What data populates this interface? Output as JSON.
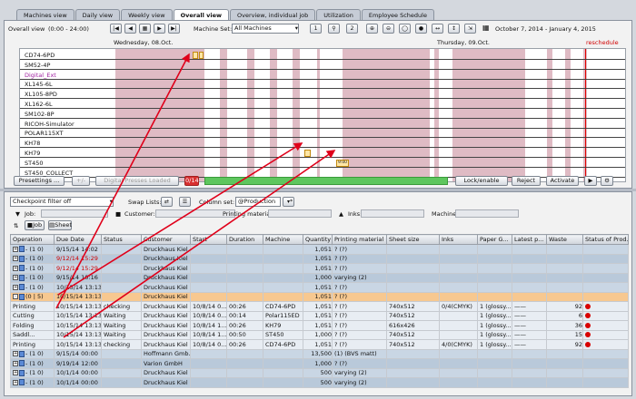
{
  "tabs": [
    {
      "label": "Machines view"
    },
    {
      "label": "Daily view"
    },
    {
      "label": "Weekly view"
    },
    {
      "label": "Overall view",
      "active": true
    },
    {
      "label": "Overview, individual job"
    },
    {
      "label": "Utilization"
    },
    {
      "label": "Employee Schedule"
    }
  ],
  "toolbar": {
    "view_label": "Overall view",
    "time_range": "(0:00 - 24:00)",
    "machine_set_label": "Machine Set:",
    "machine_set_value": "All Machines",
    "btn_one": "1",
    "btn_two": "2",
    "date_range": "October 7, 2014  -  January 4, 2015"
  },
  "gantt": {
    "day1": "Wednesday, 08.Oct.",
    "day2": "Thursday, 09.Oct.",
    "reschedule": "reschedule",
    "machines": [
      {
        "name": "CD74-6PD",
        "color": "#111111"
      },
      {
        "name": "SM52-4P",
        "color": "#111111"
      },
      {
        "name": "Digital_Ext",
        "color": "#a020a0"
      },
      {
        "name": "XL145-6L",
        "color": "#111111"
      },
      {
        "name": "XL105-8PD",
        "color": "#111111"
      },
      {
        "name": "XL162-6L",
        "color": "#111111"
      },
      {
        "name": "SM102-8P",
        "color": "#111111"
      },
      {
        "name": "RICOH-Simulator",
        "color": "#111111"
      },
      {
        "name": "POLAR115XT",
        "color": "#111111"
      },
      {
        "name": "KH78",
        "color": "#111111"
      },
      {
        "name": "KH79",
        "color": "#111111"
      },
      {
        "name": "ST450",
        "color": "#111111"
      },
      {
        "name": "ST450_COLLECT",
        "color": "#111111"
      }
    ],
    "st450_block_label": "9:00"
  },
  "bottombar": {
    "presettings": "Presettings ...",
    "digital": "Digital Presses Loaded",
    "count": "0/14",
    "lock": "Lock/enable",
    "reject": "Reject",
    "activate": "Activate"
  },
  "filters": {
    "checkpoint": "Checkpoint filter off",
    "swap_lists": "Swap Lists:",
    "column_set_label": "Column set:",
    "column_set_value": "@Production",
    "job_label": "Job:",
    "customer_label": "Customer:",
    "printing_material_label": "Printing material:",
    "inks_label": "Inks:",
    "machine_label": "Machine:",
    "job_btn": "Job",
    "sheet_btn": "Sheet"
  },
  "columns": [
    "Operation",
    "Due Date",
    "Status",
    "Customer",
    "Start",
    "Duration",
    "Machine",
    "Quantity",
    "Printing material",
    "Sheet size",
    "Inks",
    "Paper G...",
    "Latest p...",
    "Waste",
    "Status of Prod..."
  ],
  "rows": [
    {
      "kind": "job",
      "op": "- (1 0)",
      "due": "9/15/14 14:02",
      "status": "",
      "customer": "Druckhaus Kiel",
      "start": "",
      "duration": "",
      "machine": "",
      "qty": "1,051",
      "material": "? (?)",
      "sheet": "",
      "inks": "",
      "paper": "",
      "latest": "",
      "waste": "",
      "dot": false,
      "red": false
    },
    {
      "kind": "job alt",
      "op": "- (1 0)",
      "due": "9/12/14 15:29",
      "status": "",
      "customer": "Druckhaus Kiel",
      "start": "",
      "duration": "",
      "machine": "",
      "qty": "1,051",
      "material": "? (?)",
      "sheet": "",
      "inks": "",
      "paper": "",
      "latest": "",
      "waste": "",
      "dot": false,
      "red": true
    },
    {
      "kind": "job",
      "op": "- (1 0)",
      "due": "9/12/14 15:29",
      "status": "",
      "customer": "Druckhaus Kiel",
      "start": "",
      "duration": "",
      "machine": "",
      "qty": "1,051",
      "material": "? (?)",
      "sheet": "",
      "inks": "",
      "paper": "",
      "latest": "",
      "waste": "",
      "dot": false,
      "red": true
    },
    {
      "kind": "job alt",
      "op": "- (1 0)",
      "due": "9/15/14 10:16",
      "status": "",
      "customer": "Druckhaus Kiel",
      "start": "",
      "duration": "",
      "machine": "",
      "qty": "1,000",
      "material": "varying (2)",
      "sheet": "",
      "inks": "",
      "paper": "",
      "latest": "",
      "waste": "",
      "dot": false,
      "red": false
    },
    {
      "kind": "job",
      "op": "- (1 0)",
      "due": "10/15/14 13:13",
      "status": "",
      "customer": "Druckhaus Kiel",
      "start": "",
      "duration": "",
      "machine": "",
      "qty": "1,051",
      "material": "? (?)",
      "sheet": "",
      "inks": "",
      "paper": "",
      "latest": "",
      "waste": "",
      "dot": false,
      "red": false
    },
    {
      "kind": "selected",
      "op": "(0 | 5)",
      "due": "10/15/14 13:13",
      "status": "",
      "customer": "Druckhaus Kiel",
      "start": "",
      "duration": "",
      "machine": "",
      "qty": "1,051",
      "material": "? (?)",
      "sheet": "",
      "inks": "",
      "paper": "",
      "latest": "",
      "waste": "",
      "dot": false,
      "red": false
    },
    {
      "kind": "op",
      "op": "Printing",
      "due": "10/15/14 13:13",
      "status": "checking",
      "customer": "Druckhaus Kiel",
      "start": "10/8/14 0...",
      "duration": "00:26",
      "machine": "CD74-6PD",
      "qty": "1,051",
      "material": "? (?)",
      "sheet": "740x512",
      "inks": "0/4(CMYK)",
      "paper": "1 (glossy...",
      "latest": "——",
      "waste": "92",
      "dot": true,
      "red": false
    },
    {
      "kind": "op",
      "op": "Cutting",
      "due": "10/15/14 13:13",
      "status": "Waiting",
      "customer": "Druckhaus Kiel",
      "start": "10/8/14 0...",
      "duration": "00:14",
      "machine": "Polar115ED",
      "qty": "1,051",
      "material": "? (?)",
      "sheet": "740x512",
      "inks": "",
      "paper": "1 (glossy...",
      "latest": "——",
      "waste": "6",
      "dot": true,
      "red": false
    },
    {
      "kind": "op",
      "op": "Folding",
      "due": "10/15/14 13:13",
      "status": "Waiting",
      "customer": "Druckhaus Kiel",
      "start": "10/8/14 1...",
      "duration": "00:26",
      "machine": "KH79",
      "qty": "1,051",
      "material": "? (?)",
      "sheet": "616x426",
      "inks": "",
      "paper": "1 (glossy...",
      "latest": "——",
      "waste": "36",
      "dot": true,
      "red": false
    },
    {
      "kind": "op",
      "op": "Saddl...",
      "due": "10/15/14 13:13",
      "status": "Waiting",
      "customer": "Druckhaus Kiel",
      "start": "10/8/14 1...",
      "duration": "00:50",
      "machine": "ST450",
      "qty": "1,000",
      "material": "? (?)",
      "sheet": "740x512",
      "inks": "",
      "paper": "1 (glossy...",
      "latest": "——",
      "waste": "15",
      "dot": true,
      "red": false
    },
    {
      "kind": "op",
      "op": "Printing",
      "due": "10/15/14 13:13",
      "status": "checking",
      "customer": "Druckhaus Kiel",
      "start": "10/8/14 0...",
      "duration": "00:26",
      "machine": "CD74-6PD",
      "qty": "1,051",
      "material": "? (?)",
      "sheet": "740x512",
      "inks": "4/0(CMYK)",
      "paper": "1 (glossy...",
      "latest": "——",
      "waste": "92",
      "dot": true,
      "red": false
    },
    {
      "kind": "job",
      "op": "- (1 0)",
      "due": "9/15/14 00:00",
      "status": "",
      "customer": "Hoffmann Gmb...",
      "start": "",
      "duration": "",
      "machine": "",
      "qty": "13,500",
      "material": "(1) (BVS matt)",
      "sheet": "",
      "inks": "",
      "paper": "",
      "latest": "",
      "waste": "",
      "dot": false,
      "red": false
    },
    {
      "kind": "job alt",
      "op": "- (1 0)",
      "due": "9/19/14 12:00",
      "status": "",
      "customer": "Varion GmbH",
      "start": "",
      "duration": "",
      "machine": "",
      "qty": "1,000",
      "material": "? (?)",
      "sheet": "",
      "inks": "",
      "paper": "",
      "latest": "",
      "waste": "",
      "dot": false,
      "red": false
    },
    {
      "kind": "job",
      "op": "- (1 0)",
      "due": "10/1/14 00:00",
      "status": "",
      "customer": "Druckhaus Kiel",
      "start": "",
      "duration": "",
      "machine": "",
      "qty": "500",
      "material": "varying (2)",
      "sheet": "",
      "inks": "",
      "paper": "",
      "latest": "",
      "waste": "",
      "dot": false,
      "red": false
    },
    {
      "kind": "job alt",
      "op": "- (1 0)",
      "due": "10/1/14 00:00",
      "status": "",
      "customer": "Druckhaus Kiel",
      "start": "",
      "duration": "",
      "machine": "",
      "qty": "500",
      "material": "varying (2)",
      "sheet": "",
      "inks": "",
      "paper": "",
      "latest": "",
      "waste": "",
      "dot": false,
      "red": false
    }
  ]
}
